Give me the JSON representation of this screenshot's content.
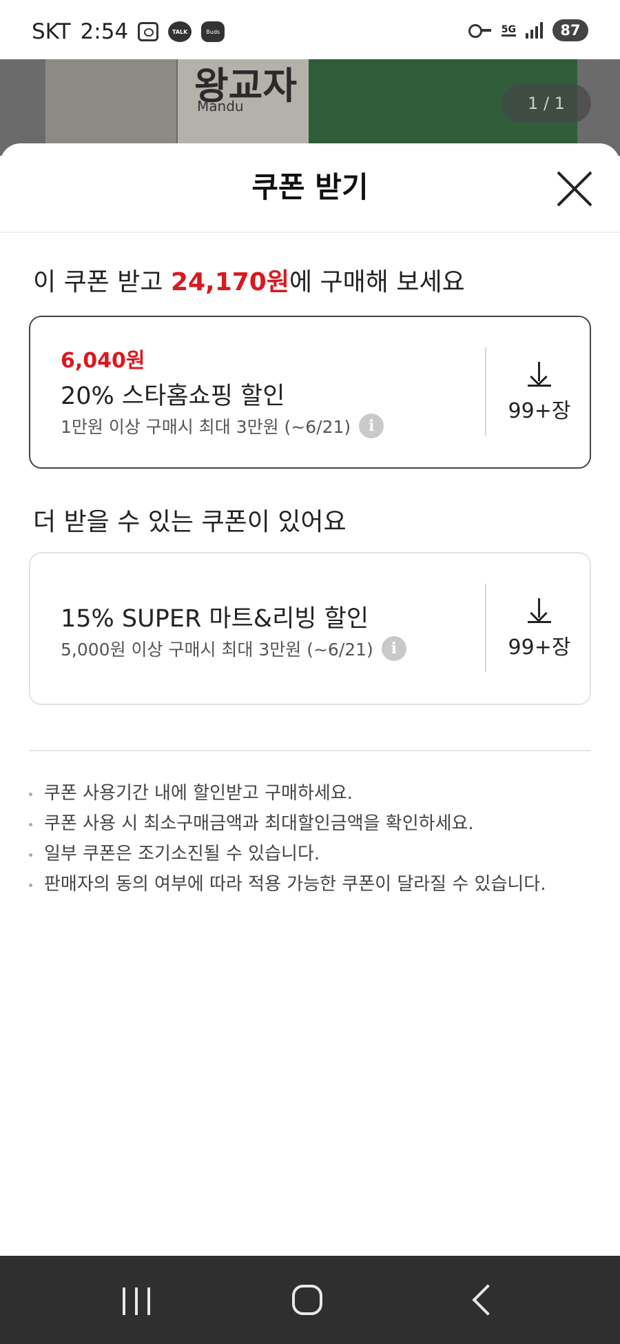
{
  "status_bar": {
    "carrier": "SKT",
    "time": "2:54",
    "talk_label": "TALK",
    "buds_label": "Buds",
    "network": "5G",
    "battery": "87"
  },
  "background": {
    "product_title": "왕교자",
    "product_subtitle": "Mandu",
    "pager": "1 / 1"
  },
  "sheet": {
    "title": "쿠폰 받기",
    "headline_prefix": "이 쿠폰 받고 ",
    "headline_price": "24,170원",
    "headline_suffix": "에 구매해 보세요",
    "more_headline": "더 받을 수 있는 쿠폰이 있어요"
  },
  "coupons": [
    {
      "amount": "6,040원",
      "name": "20% 스타홈쇼핑 할인",
      "description": "1만원 이상 구매시 최대 3만원 (~6/21)",
      "count": "99+장"
    },
    {
      "name": "15% SUPER 마트&리빙 할인",
      "description": "5,000원 이상 구매시 최대 3만원 (~6/21)",
      "count": "99+장"
    }
  ],
  "notices": [
    "쿠폰 사용기간 내에 할인받고 구매하세요.",
    "쿠폰 사용 시 최소구매금액과 최대할인금액을 확인하세요.",
    "일부 쿠폰은 조기소진될 수 있습니다.",
    "판매자의 동의 여부에 따라 적용 가능한 쿠폰이 달라질 수 있습니다."
  ],
  "colors": {
    "accent_red": "#d9181f",
    "nav_bar": "#2f2f2f"
  },
  "icons": [
    "gallery-icon",
    "kakaotalk-icon",
    "buds-icon",
    "key-icon",
    "signal-icon",
    "battery-icon",
    "close-icon",
    "download-icon",
    "info-icon",
    "recents-icon",
    "home-icon",
    "back-icon"
  ]
}
